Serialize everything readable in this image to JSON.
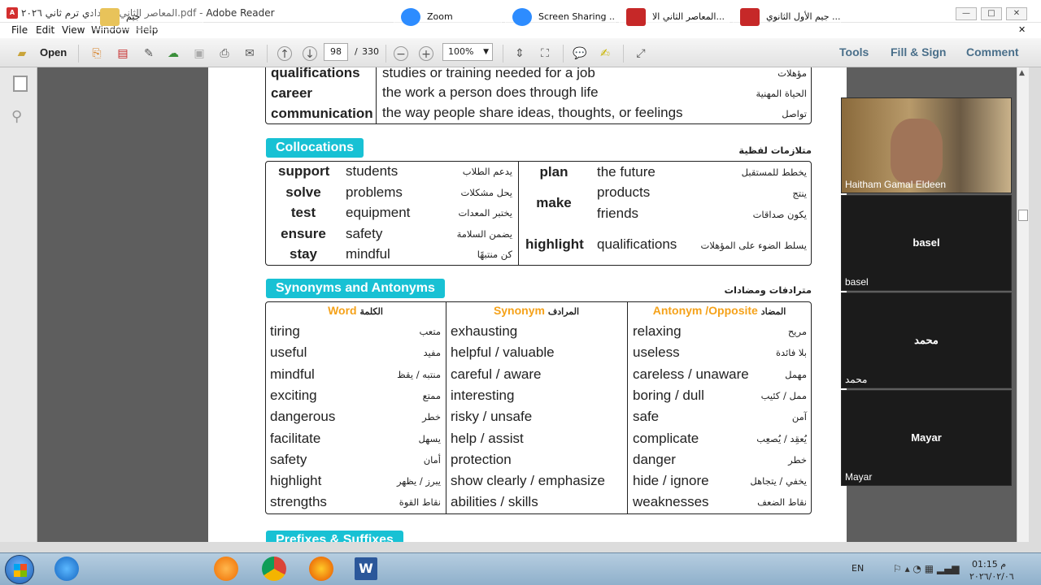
{
  "window": {
    "title": "المعاصر الثاني الاعدادي ترم ثاني ٢٠٢٦.pdf - Adobe Reader",
    "min": "—",
    "max": "□",
    "close": "✕",
    "menu_close": "✕"
  },
  "menu": {
    "file": "File",
    "edit": "Edit",
    "view": "View",
    "window": "Window",
    "help": "Help"
  },
  "toolbar": {
    "open": "Open",
    "page_current": "98",
    "page_sep": "/",
    "page_total": "330",
    "zoom": "100%",
    "tools": "Tools",
    "fill_sign": "Fill & Sign",
    "comment": "Comment"
  },
  "vocab_top": [
    {
      "word": "qualifications",
      "def": "studies or training needed for a job",
      "ar": "مؤهلات"
    },
    {
      "word": "career",
      "def": "the work a person does through life",
      "ar": "الحياة المهنية"
    },
    {
      "word": "communication",
      "def": "the way people share ideas, thoughts, or feelings",
      "ar": "تواصل"
    }
  ],
  "collocations": {
    "header": "Collocations",
    "header_ar": "متلازمات لفظية",
    "left": [
      {
        "verb": "support",
        "noun": "students",
        "ar": "يدعم الطلاب"
      },
      {
        "verb": "solve",
        "noun": "problems",
        "ar": "يحل مشكلات"
      },
      {
        "verb": "test",
        "noun": "equipment",
        "ar": "يختبر المعدات"
      },
      {
        "verb": "ensure",
        "noun": "safety",
        "ar": "يضمن السلامة"
      },
      {
        "verb": "stay",
        "noun": "mindful",
        "ar": "كن منتبهًا"
      }
    ],
    "right": {
      "plan": {
        "verb": "plan",
        "noun": "the future",
        "ar": "يخطط للمستقبل"
      },
      "make": {
        "verb": "make",
        "noun1": "products",
        "ar1": "ينتج",
        "noun2": "friends",
        "ar2": "يكون صداقات"
      },
      "highlight": {
        "verb": "highlight",
        "noun": "qualifications",
        "ar": "يسلط الضوء على المؤهلات"
      }
    }
  },
  "synonyms": {
    "header": "Synonyms and Antonyms",
    "header_ar": "مترادفات ومضادات",
    "col_word": "Word",
    "col_word_ar": "الكلمة",
    "col_syn": "Synonym",
    "col_syn_ar": "المرادف",
    "col_ant": "Antonym /Opposite",
    "col_ant_ar": "المضاد",
    "rows": [
      {
        "word": "tiring",
        "word_ar": "متعب",
        "syn": "exhausting",
        "ant": "relaxing",
        "ant_ar": "مريح"
      },
      {
        "word": "useful",
        "word_ar": "مفيد",
        "syn": "helpful / valuable",
        "ant": "useless",
        "ant_ar": "بلا فائدة"
      },
      {
        "word": "mindful",
        "word_ar": "منتبه / يقظ",
        "syn": "careful / aware",
        "ant": "careless / unaware",
        "ant_ar": "مهمل"
      },
      {
        "word": "exciting",
        "word_ar": "ممتع",
        "syn": "interesting",
        "ant": "boring / dull",
        "ant_ar": "ممل / كئيب"
      },
      {
        "word": "dangerous",
        "word_ar": "خطر",
        "syn": "risky / unsafe",
        "ant": "safe",
        "ant_ar": "آمن"
      },
      {
        "word": "facilitate",
        "word_ar": "يسهل",
        "syn": "help / assist",
        "ant": "complicate",
        "ant_ar": "يُعقِد / يُصعِب"
      },
      {
        "word": "safety",
        "word_ar": "أمان",
        "syn": "protection",
        "ant": "danger",
        "ant_ar": "خطر"
      },
      {
        "word": "highlight",
        "word_ar": "يبرز / يظهر",
        "syn": "show clearly / emphasize",
        "ant": "hide / ignore",
        "ant_ar": "يخفي / يتجاهل"
      },
      {
        "word": "strengths",
        "word_ar": "نقاط القوة",
        "syn": "abilities / skills",
        "ant": "weaknesses",
        "ant_ar": "نقاط الضعف"
      }
    ]
  },
  "next_section": "Prefixes & Suffixes",
  "participants": [
    {
      "name": "Haitham Gamal Eldeen",
      "center": ""
    },
    {
      "name": "basel",
      "center": "basel"
    },
    {
      "name": "محمد",
      "center": "محمد"
    },
    {
      "name": "Mayar",
      "center": "Mayar"
    }
  ],
  "taskbar": {
    "folder": "جيم",
    "zoom": "Zoom",
    "screen_sharing": "Screen Sharing ...",
    "pdf1": "المعاصر الثاني الا...",
    "pdf2": "جيم الأول الثانوي ...",
    "lang": "EN",
    "time": "01:15 م",
    "date": "٢٠٢٦/٠٢/٠٦"
  },
  "colors": {
    "teal": "#18c1d4",
    "orange": "#f5a21a",
    "taskbar": "#9fbdd4"
  }
}
